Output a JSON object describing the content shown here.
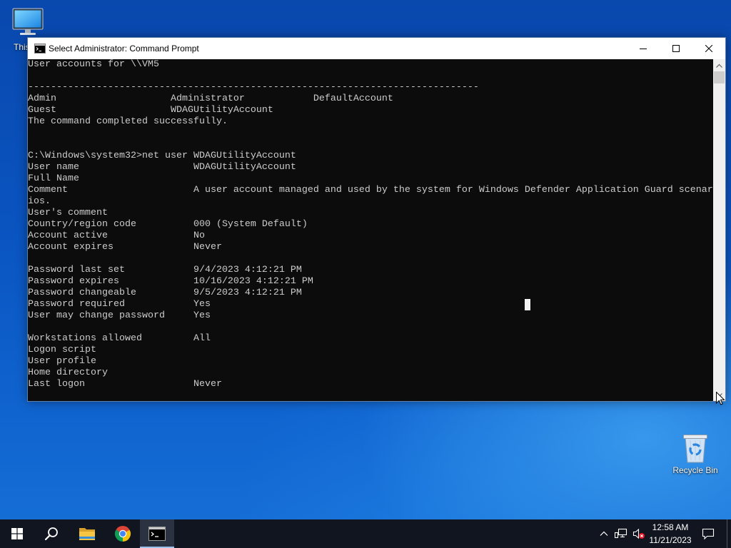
{
  "window": {
    "title": "Select Administrator: Command Prompt",
    "title_icon": "cmd-icon",
    "controls": [
      "minimize-icon",
      "maximize-icon",
      "close-icon"
    ]
  },
  "console": {
    "lines": [
      "User accounts for \\\\VM5",
      "",
      "-------------------------------------------------------------------------------",
      "Admin                    Administrator            DefaultAccount",
      "Guest                    WDAGUtilityAccount",
      "The command completed successfully.",
      "",
      "",
      "C:\\Windows\\system32>net user WDAGUtilityAccount",
      "User name                    WDAGUtilityAccount",
      "Full Name",
      "Comment                      A user account managed and used by the system for Windows Defender Application Guard scenar",
      "ios.",
      "User's comment",
      "Country/region code          000 (System Default)",
      "Account active               No",
      "Account expires              Never",
      "",
      "Password last set            9/4/2023 4:12:21 PM",
      "Password expires             10/16/2023 4:12:21 PM",
      "Password changeable          9/5/2023 4:12:21 PM",
      "Password required            Yes",
      "User may change password     Yes",
      "",
      "Workstations allowed         All",
      "Logon script",
      "User profile",
      "Home directory",
      "Last logon                   Never"
    ],
    "scroll_position": 0
  },
  "desktop": {
    "icons": [
      {
        "label": "This",
        "icon": "this-pc-icon"
      },
      {
        "label": "Recycle Bin",
        "icon": "recycle-bin-icon"
      }
    ]
  },
  "taskbar": {
    "start": {
      "icon": "windows-logo-icon"
    },
    "pinned": [
      {
        "icon": "search-icon"
      },
      {
        "icon": "file-explorer-icon"
      },
      {
        "icon": "chrome-icon"
      },
      {
        "icon": "command-prompt-icon",
        "active": true
      }
    ],
    "tray": [
      {
        "icon": "chevron-up-icon"
      },
      {
        "icon": "network-icon"
      },
      {
        "icon": "volume-muted-icon"
      }
    ],
    "clock": {
      "time": "12:58 AM",
      "date": "11/21/2023"
    },
    "action_center": {
      "icon": "action-center-icon"
    }
  },
  "colors": {
    "console_bg": "#0c0c0c",
    "console_text": "#cccccc",
    "selection_cursor": "#f2f2f2",
    "taskbar_bg": "#10151f",
    "active_underline": "#9dc2ee"
  }
}
